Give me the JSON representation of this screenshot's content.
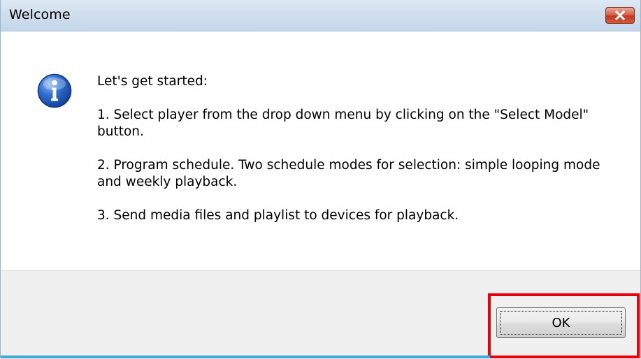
{
  "window": {
    "title": "Welcome"
  },
  "icons": {
    "close": "close-icon",
    "info": "info-icon"
  },
  "message": {
    "heading": "Let's get started:",
    "step1": "1. Select player from the drop down menu by clicking on the \"Select Model\" button.",
    "step2": "2. Program schedule. Two schedule modes for selection: simple looping mode and weekly playback.",
    "step3": "3. Send media files and playlist to devices for playback."
  },
  "buttons": {
    "ok_label": "OK"
  },
  "colors": {
    "highlight": "#e8000b",
    "titlebar": "#cfdeed",
    "footer": "#f0f0f0",
    "close_button": "#c23a20"
  }
}
